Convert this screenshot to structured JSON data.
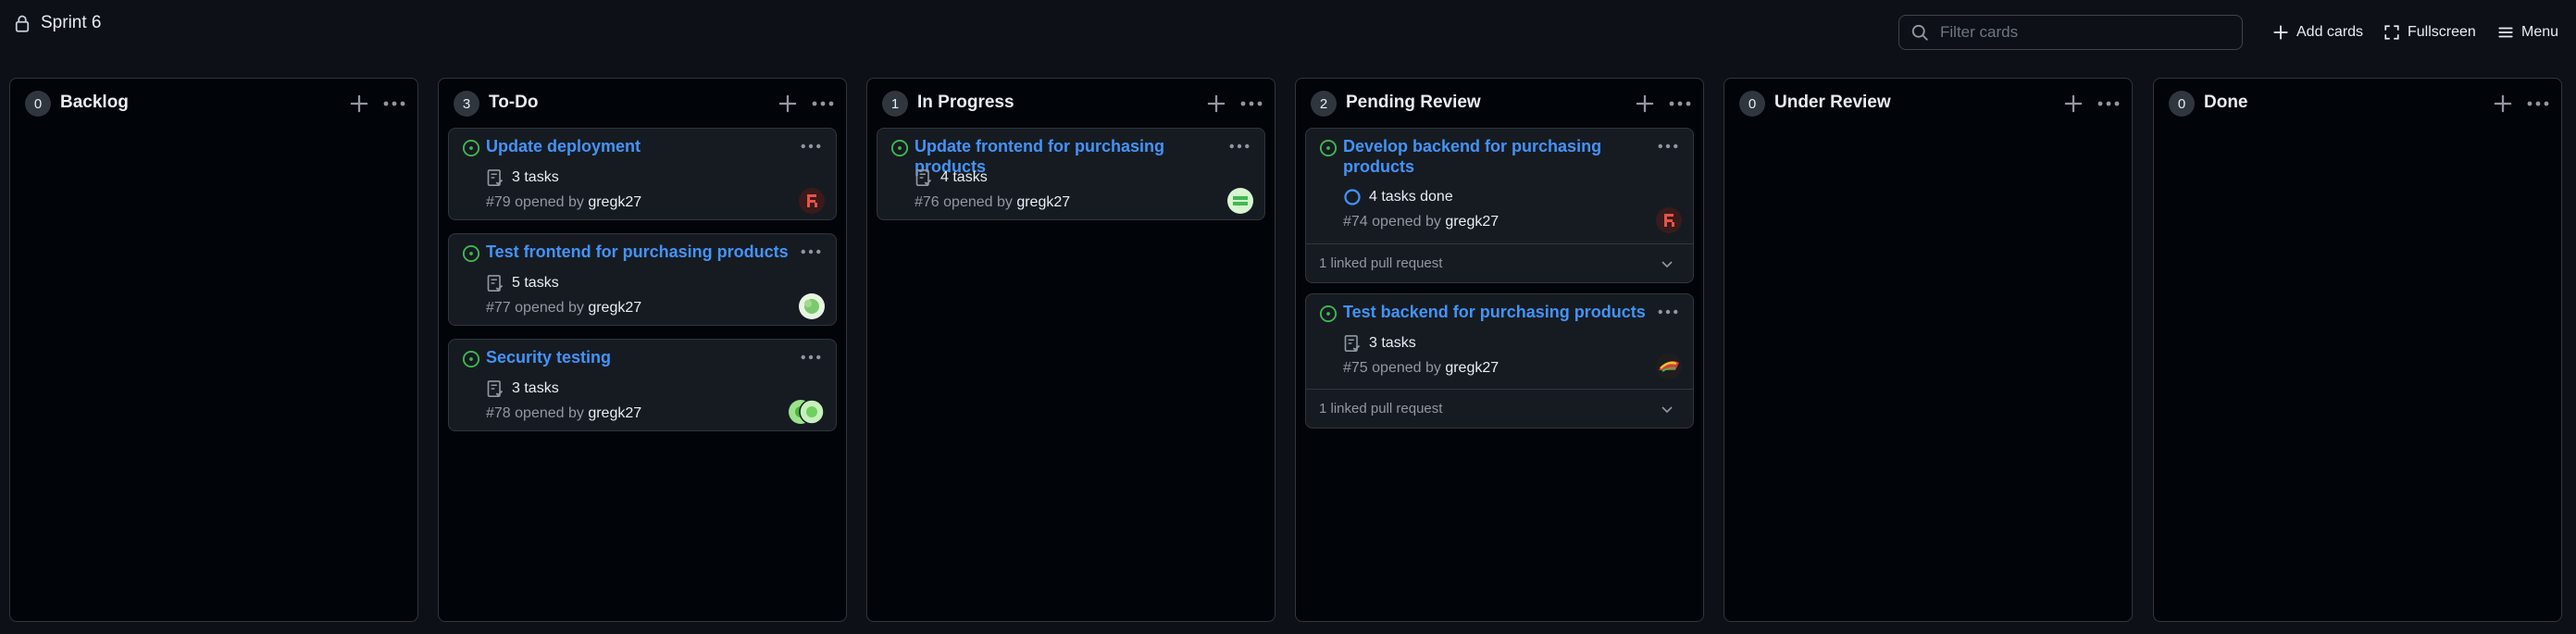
{
  "project": {
    "title": "Sprint 6"
  },
  "toolbar": {
    "filter_placeholder": "Filter cards",
    "add_cards": "Add cards",
    "fullscreen": "Fullscreen",
    "menu": "Menu"
  },
  "columns": [
    {
      "name": "Backlog",
      "count": "0",
      "cards": []
    },
    {
      "name": "To-Do",
      "count": "3",
      "cards": [
        {
          "title": "Update deployment",
          "tasks": "3 tasks",
          "number": "#79 opened by",
          "user": "gregk27",
          "avatar": "avatar-red-pattern"
        },
        {
          "title": "Test frontend for purchasing products",
          "tasks": "5 tasks",
          "number": "#77 opened by",
          "user": "gregk27",
          "avatar": "avatar-green-blob"
        },
        {
          "title": "Security testing",
          "tasks": "3 tasks",
          "number": "#78 opened by",
          "user": "gregk27",
          "avatar": "avatar-stack"
        }
      ]
    },
    {
      "name": "In Progress",
      "count": "1",
      "cards": [
        {
          "title": "Update frontend for purchasing products",
          "tasks": "4 tasks",
          "number": "#76 opened by",
          "user": "gregk27",
          "avatar": "avatar-green-pattern"
        }
      ]
    },
    {
      "name": "Pending Review",
      "count": "2",
      "cards": [
        {
          "title": "Develop backend for purchasing products",
          "tasks": "4 tasks done",
          "number": "#74 opened by",
          "user": "gregk27",
          "avatar": "avatar-red-pattern",
          "linked": "1 linked pull request"
        },
        {
          "title": "Test backend for purchasing products",
          "tasks": "3 tasks",
          "number": "#75 opened by",
          "user": "gregk27",
          "avatar": "avatar-flag",
          "linked": "1 linked pull request"
        }
      ]
    },
    {
      "name": "Under Review",
      "count": "0",
      "cards": []
    },
    {
      "name": "Done",
      "count": "0",
      "cards": []
    }
  ],
  "colors": {
    "background": "#0d1117",
    "column_bg": "#010409",
    "card_bg": "#161b22",
    "link": "#4493f8",
    "open_status": "#3fb950",
    "muted": "#9198a1"
  }
}
